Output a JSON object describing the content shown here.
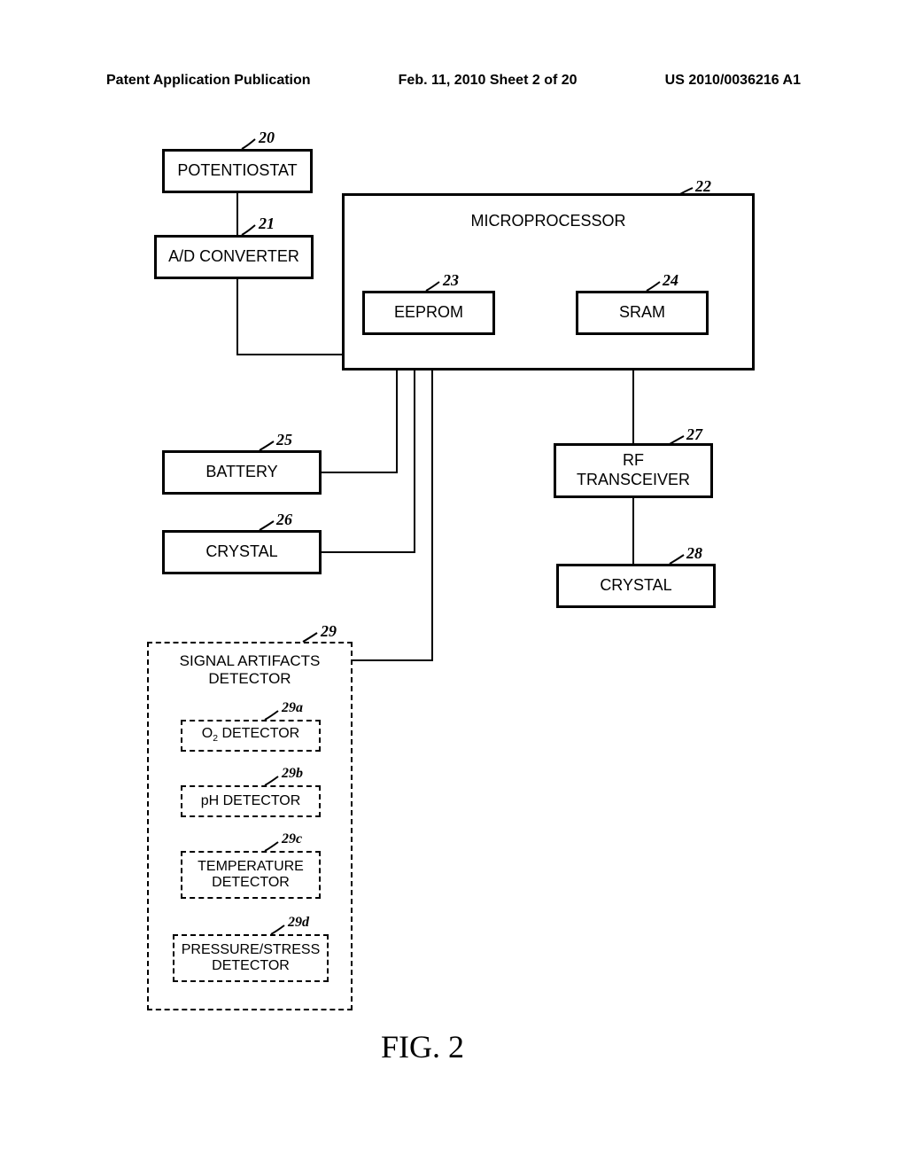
{
  "header": {
    "left": "Patent Application Publication",
    "center": "Feb. 11, 2010   Sheet 2 of 20",
    "right": "US 2010/0036216 A1"
  },
  "blocks": {
    "potentiostat": "POTENTIOSTAT",
    "ad_converter": "A/D CONVERTER",
    "microprocessor": "MICROPROCESSOR",
    "eeprom": "EEPROM",
    "sram": "SRAM",
    "battery": "BATTERY",
    "crystal_left": "CRYSTAL",
    "rf_transceiver_l1": "RF",
    "rf_transceiver_l2": "TRANSCEIVER",
    "crystal_right": "CRYSTAL",
    "signal_artifacts_l1": "SIGNAL ARTIFACTS",
    "signal_artifacts_l2": "DETECTOR",
    "o2_pre": "O",
    "o2_post": " DETECTOR",
    "ph_detector": "pH DETECTOR",
    "temperature_l1": "TEMPERATURE",
    "temperature_l2": "DETECTOR",
    "pressure_l1": "PRESSURE/STRESS",
    "pressure_l2": "DETECTOR"
  },
  "refs": {
    "r20": "20",
    "r21": "21",
    "r22": "22",
    "r23": "23",
    "r24": "24",
    "r25": "25",
    "r26": "26",
    "r27": "27",
    "r28": "28",
    "r29": "29",
    "r29a": "29a",
    "r29b": "29b",
    "r29c": "29c",
    "r29d": "29d"
  },
  "figure_caption": "FIG. 2"
}
